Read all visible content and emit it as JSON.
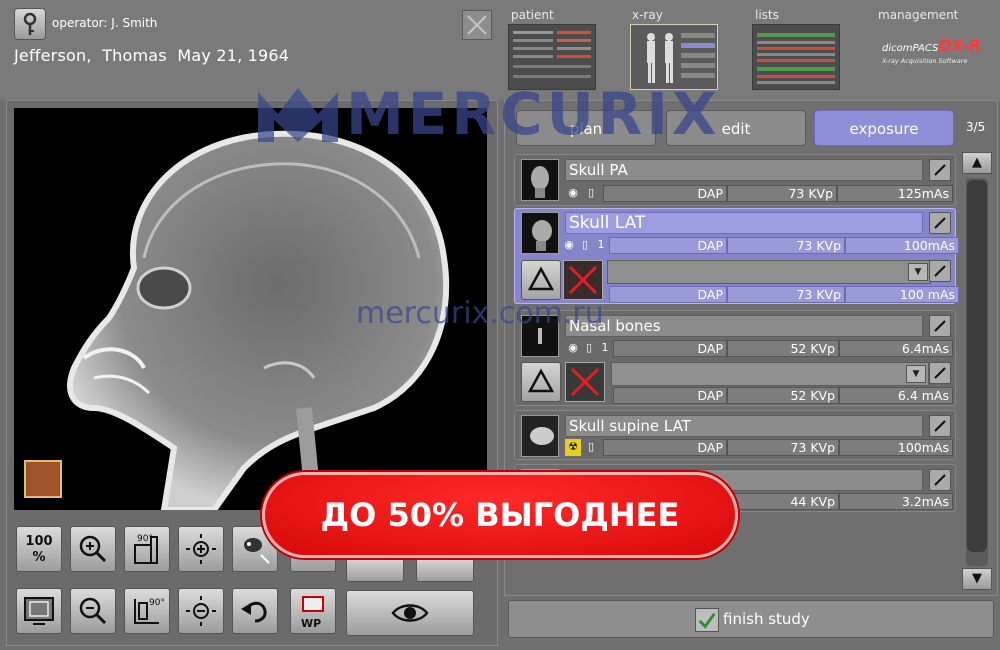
{
  "header": {
    "operator_label": "operator:",
    "operator_name": "J. Smith",
    "patient_line": "Jefferson,  Thomas  May 21, 1964"
  },
  "nav": {
    "tabs": [
      {
        "label": "patient"
      },
      {
        "label": "x-ray"
      },
      {
        "label": "lists"
      },
      {
        "label": "management"
      }
    ]
  },
  "brand": {
    "name": "dicomPACS",
    "suffix": "DX-R",
    "tagline": "X-ray Acquisition Software"
  },
  "watermark": {
    "logo_text": "MERCURIX",
    "url_text": "mercurix.com.ru"
  },
  "viewer": {
    "toolbar": {
      "zoom_fit_label": "100\n%",
      "rotate_label": "90°",
      "flip_label": "90°",
      "wp_label": "WP"
    }
  },
  "plan_tabs": [
    {
      "label": "plan",
      "active": false
    },
    {
      "label": "edit",
      "active": false
    },
    {
      "label": "exposure",
      "active": true
    }
  ],
  "position_counter": "3/5",
  "exams": [
    {
      "name": "Skull PA",
      "count": "",
      "dap": "DAP",
      "kvp": "73 KVp",
      "mas": "125mAs"
    },
    {
      "name": "Skull LAT",
      "count": "1",
      "dap": "DAP",
      "kvp": "73 KVp",
      "mas": "100mAs",
      "sub": {
        "dap": "DAP",
        "kvp": "73 KVp",
        "mas": "100 mAs"
      }
    },
    {
      "name": "Nasal bones",
      "count": "1",
      "dap": "DAP",
      "kvp": "52 KVp",
      "mas": "6.4mAs",
      "sub": {
        "dap": "DAP",
        "kvp": "52 KVp",
        "mas": "6.4 mAs"
      }
    },
    {
      "name": "Skull supine LAT",
      "count": "",
      "dap": "DAP",
      "kvp": "73 KVp",
      "mas": "100mAs"
    },
    {
      "name": "",
      "count": "",
      "dap": "",
      "kvp": "44 KVp",
      "mas": "3.2mAs"
    }
  ],
  "finish": {
    "label": "finish study"
  },
  "promo": {
    "text": "ДО 50% ВЫГОДНЕЕ"
  },
  "colors": {
    "accent": "#8f8fd9",
    "selected_row": "#8585c9",
    "promo": "#e01010"
  }
}
